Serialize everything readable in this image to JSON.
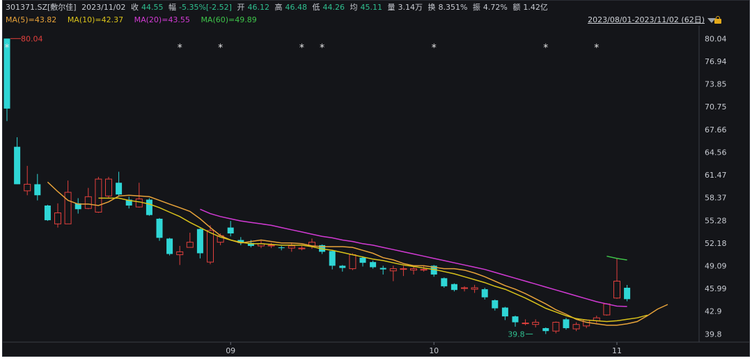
{
  "header": {
    "symbol": "301371.SZ[敷尔佳]",
    "date": "2023/11/02",
    "close_label": "收",
    "close_value": "44.55",
    "change_label": "幅",
    "change_value": "-5.35%[-2.52]",
    "open_label": "开",
    "open_value": "46.12",
    "high_label": "高",
    "high_value": "46.48",
    "low_label": "低",
    "low_value": "44.26",
    "avg_label": "均",
    "avg_value": "45.11",
    "volume_label": "量",
    "volume_value": "3.14万",
    "turnover_label": "换",
    "turnover_value": "8.351%",
    "amplitude_label": "振",
    "amplitude_value": "4.72%",
    "amount_label": "额",
    "amount_value": "1.42亿"
  },
  "ma_legend": [
    {
      "label": "MA(5)=43.82",
      "color": "#e8a33a"
    },
    {
      "label": "MA(10)=42.37",
      "color": "#d9c21a"
    },
    {
      "label": "MA(20)=43.55",
      "color": "#d23ad4"
    },
    {
      "label": "MA(60)=49.89",
      "color": "#3ec44a"
    }
  ],
  "range_label": "2023/08/01-2023/11/02 (62日)",
  "colors": {
    "up": "#e2403d",
    "down": "#2fd6d6",
    "background": "#141519"
  },
  "chart_data": {
    "type": "candlestick",
    "y_ticks": [
      80.04,
      76.94,
      73.85,
      70.75,
      67.66,
      64.56,
      61.47,
      58.37,
      55.28,
      52.18,
      49.09,
      45.99,
      42.9,
      39.8
    ],
    "ylim": [
      38.7,
      81.4
    ],
    "x_tick_labels": [
      {
        "label": "09",
        "index": 22
      },
      {
        "label": "10",
        "index": 42
      },
      {
        "label": "11",
        "index": 60
      }
    ],
    "annotations": [
      {
        "text": "80.04",
        "index": 0,
        "value": 80.04,
        "color": "#e2403d"
      },
      {
        "text": "39.8",
        "index": 52,
        "value": 39.8,
        "color": "#2fbf8f"
      }
    ],
    "event_markers": [
      0,
      17,
      21,
      29,
      31,
      42,
      53,
      58
    ],
    "candles": [
      {
        "o": 80.04,
        "c": 70.5,
        "h": 80.04,
        "l": 68.8
      },
      {
        "o": 65.3,
        "c": 60.2,
        "h": 66.6,
        "l": 60.2
      },
      {
        "o": 59.3,
        "c": 60.2,
        "h": 62.7,
        "l": 58.7
      },
      {
        "o": 60.2,
        "c": 58.7,
        "h": 61.6,
        "l": 58.0
      },
      {
        "o": 57.3,
        "c": 55.3,
        "h": 57.4,
        "l": 55.2
      },
      {
        "o": 54.8,
        "c": 56.3,
        "h": 57.6,
        "l": 54.3
      },
      {
        "o": 54.8,
        "c": 59.1,
        "h": 60.7,
        "l": 54.8
      },
      {
        "o": 57.6,
        "c": 56.8,
        "h": 58.3,
        "l": 56.2
      },
      {
        "o": 56.9,
        "c": 58.5,
        "h": 59.7,
        "l": 56.8
      },
      {
        "o": 56.4,
        "c": 60.9,
        "h": 61.2,
        "l": 56.3
      },
      {
        "o": 58.6,
        "c": 60.9,
        "h": 61.2,
        "l": 58.3
      },
      {
        "o": 60.4,
        "c": 58.8,
        "h": 61.9,
        "l": 58.6
      },
      {
        "o": 58.1,
        "c": 57.3,
        "h": 58.5,
        "l": 56.9
      },
      {
        "o": 57.1,
        "c": 58.2,
        "h": 60.4,
        "l": 57.0
      },
      {
        "o": 58.1,
        "c": 56.0,
        "h": 58.3,
        "l": 55.9
      },
      {
        "o": 55.5,
        "c": 52.9,
        "h": 55.6,
        "l": 52.5
      },
      {
        "o": 52.8,
        "c": 50.7,
        "h": 52.9,
        "l": 50.5
      },
      {
        "o": 50.6,
        "c": 51.0,
        "h": 51.8,
        "l": 49.2
      },
      {
        "o": 51.6,
        "c": 52.3,
        "h": 53.6,
        "l": 51.6
      },
      {
        "o": 54.1,
        "c": 50.8,
        "h": 54.2,
        "l": 50.1
      },
      {
        "o": 49.6,
        "c": 53.9,
        "h": 54.6,
        "l": 49.3
      },
      {
        "o": 52.3,
        "c": 53.2,
        "h": 53.5,
        "l": 51.9
      },
      {
        "o": 54.3,
        "c": 53.5,
        "h": 55.2,
        "l": 53.1
      },
      {
        "o": 52.6,
        "c": 52.2,
        "h": 53.0,
        "l": 51.9
      },
      {
        "o": 52.2,
        "c": 51.8,
        "h": 52.6,
        "l": 51.6
      },
      {
        "o": 51.8,
        "c": 52.1,
        "h": 52.5,
        "l": 51.5
      },
      {
        "o": 51.8,
        "c": 51.9,
        "h": 52.2,
        "l": 51.5
      },
      {
        "o": 51.6,
        "c": 51.5,
        "h": 51.8,
        "l": 51.2
      },
      {
        "o": 51.5,
        "c": 51.8,
        "h": 52.2,
        "l": 51.0
      },
      {
        "o": 51.5,
        "c": 51.5,
        "h": 51.8,
        "l": 51.2
      },
      {
        "o": 51.8,
        "c": 52.3,
        "h": 52.8,
        "l": 51.4
      },
      {
        "o": 51.9,
        "c": 51.0,
        "h": 52.0,
        "l": 50.7
      },
      {
        "o": 51.1,
        "c": 49.1,
        "h": 51.2,
        "l": 48.6
      },
      {
        "o": 49.1,
        "c": 48.8,
        "h": 49.2,
        "l": 48.3
      },
      {
        "o": 48.7,
        "c": 50.6,
        "h": 50.8,
        "l": 48.5
      },
      {
        "o": 50.2,
        "c": 49.5,
        "h": 50.4,
        "l": 49.0
      },
      {
        "o": 49.6,
        "c": 48.9,
        "h": 49.8,
        "l": 48.7
      },
      {
        "o": 48.8,
        "c": 48.6,
        "h": 49.1,
        "l": 47.9
      },
      {
        "o": 48.4,
        "c": 48.7,
        "h": 49.1,
        "l": 47.0
      },
      {
        "o": 48.6,
        "c": 48.7,
        "h": 49.1,
        "l": 47.7
      },
      {
        "o": 48.5,
        "c": 48.7,
        "h": 49.1,
        "l": 47.9
      },
      {
        "o": 48.6,
        "c": 48.6,
        "h": 49.1,
        "l": 48.3
      },
      {
        "o": 49.1,
        "c": 47.9,
        "h": 49.2,
        "l": 47.6
      },
      {
        "o": 47.4,
        "c": 46.3,
        "h": 47.5,
        "l": 46.1
      },
      {
        "o": 46.6,
        "c": 45.8,
        "h": 46.7,
        "l": 45.6
      },
      {
        "o": 46.0,
        "c": 46.1,
        "h": 46.3,
        "l": 45.6
      },
      {
        "o": 45.9,
        "c": 46.1,
        "h": 46.5,
        "l": 45.4
      },
      {
        "o": 45.9,
        "c": 44.8,
        "h": 46.1,
        "l": 44.5
      },
      {
        "o": 44.4,
        "c": 43.3,
        "h": 44.5,
        "l": 43.0
      },
      {
        "o": 43.4,
        "c": 42.2,
        "h": 43.5,
        "l": 41.7
      },
      {
        "o": 42.2,
        "c": 41.4,
        "h": 42.3,
        "l": 40.8
      },
      {
        "o": 41.3,
        "c": 41.3,
        "h": 41.8,
        "l": 41.0
      },
      {
        "o": 41.1,
        "c": 41.4,
        "h": 41.8,
        "l": 40.7
      },
      {
        "o": 40.6,
        "c": 40.2,
        "h": 40.7,
        "l": 39.8
      },
      {
        "o": 40.2,
        "c": 41.4,
        "h": 41.5,
        "l": 39.9
      },
      {
        "o": 41.8,
        "c": 40.6,
        "h": 42.0,
        "l": 40.4
      },
      {
        "o": 40.5,
        "c": 41.1,
        "h": 41.4,
        "l": 40.2
      },
      {
        "o": 40.9,
        "c": 41.7,
        "h": 41.8,
        "l": 40.6
      },
      {
        "o": 41.6,
        "c": 42.0,
        "h": 42.3,
        "l": 41.3
      },
      {
        "o": 42.4,
        "c": 43.9,
        "h": 44.0,
        "l": 42.3
      },
      {
        "o": 44.7,
        "c": 47.0,
        "h": 50.1,
        "l": 44.6
      },
      {
        "o": 46.1,
        "c": 44.55,
        "h": 46.48,
        "l": 44.26
      }
    ],
    "ma_series": [
      {
        "name": "MA(5)",
        "start": 4,
        "values": [
          60.5,
          59.2,
          58.0,
          57.5,
          57.5,
          57.3,
          57.8,
          58.6,
          58.7,
          58.6,
          58.5,
          58.0,
          57.5,
          57.0,
          56.5,
          55.5,
          54.3,
          53.2,
          52.6,
          52.2,
          52.4,
          52.6,
          52.4,
          52.2,
          52.2,
          52.1,
          51.8,
          51.7,
          51.7,
          51.7,
          51.6,
          51.2,
          50.8,
          50.2,
          49.9,
          49.4,
          49.1,
          49.1,
          48.9,
          48.7,
          48.7,
          48.5,
          48.1,
          47.6,
          47.0,
          46.4,
          45.9,
          45.3,
          44.6,
          43.9,
          43.1,
          42.5,
          41.8,
          41.4,
          41.2,
          41.0,
          41.0,
          41.2,
          41.5,
          42.3,
          43.2,
          43.82
        ]
      },
      {
        "name": "MA(10)",
        "start": 9,
        "values": [
          58.3,
          58.3,
          58.3,
          58.0,
          57.8,
          57.5,
          57.0,
          56.4,
          55.8,
          55.0,
          54.3,
          53.6,
          53.0,
          52.6,
          52.3,
          52.1,
          52.1,
          52.0,
          51.9,
          51.9,
          51.9,
          51.7,
          51.4,
          51.2,
          50.9,
          50.6,
          50.3,
          50.0,
          49.8,
          49.5,
          49.2,
          49.0,
          48.8,
          48.6,
          48.3,
          48.0,
          47.6,
          47.2,
          46.8,
          46.3,
          45.9,
          45.3,
          44.7,
          44.0,
          43.3,
          42.8,
          42.3,
          41.9,
          41.7,
          41.6,
          41.5,
          41.6,
          41.8,
          42.0,
          42.37
        ]
      },
      {
        "name": "MA(20)",
        "start": 19,
        "values": [
          56.8,
          56.2,
          55.8,
          55.5,
          55.2,
          55.0,
          54.8,
          54.6,
          54.3,
          54.0,
          53.7,
          53.4,
          53.1,
          52.9,
          52.6,
          52.4,
          52.1,
          51.9,
          51.6,
          51.3,
          51.0,
          50.7,
          50.4,
          50.1,
          49.8,
          49.5,
          49.2,
          48.9,
          48.6,
          48.2,
          47.8,
          47.4,
          47.0,
          46.6,
          46.2,
          45.8,
          45.4,
          45.0,
          44.6,
          44.2,
          43.9,
          43.6,
          43.55
        ]
      },
      {
        "name": "MA(60)",
        "start": 59,
        "values": [
          50.4,
          50.1,
          49.89
        ]
      }
    ]
  }
}
